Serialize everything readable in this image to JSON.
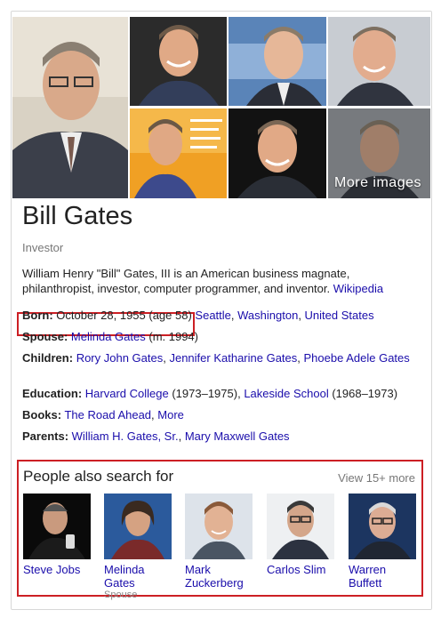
{
  "gallery": {
    "more_images_label": "More images"
  },
  "entity": {
    "name": "Bill Gates",
    "type": "Investor",
    "description": "William Henry \"Bill\" Gates, III is an American business magnate, philanthropist, investor, computer programmer, and inventor.",
    "source_link": "Wikipedia"
  },
  "facts": {
    "born": {
      "label": "Born:",
      "value": "October 28, 1955 (age 58)",
      "links": [
        "Seattle",
        "Washington",
        "United States"
      ]
    },
    "spouse": {
      "label": "Spouse:",
      "link": "Melinda Gates",
      "suffix": " (m. 1994)"
    },
    "children": {
      "label": "Children:",
      "links": [
        "Rory John Gates",
        "Jennifer Katharine Gates",
        "Phoebe Adele Gates"
      ]
    },
    "education": {
      "label": "Education:",
      "link1": "Harvard College",
      "years1": " (1973–1975), ",
      "link2": "Lakeside School",
      "years2": " (1968–1973)"
    },
    "books": {
      "label": "Books:",
      "link1": "The Road Ahead",
      "link2": "More"
    },
    "parents": {
      "label": "Parents:",
      "links": [
        "William H. Gates, Sr.",
        "Mary Maxwell Gates"
      ]
    }
  },
  "people_also_search": {
    "title": "People also search for",
    "view_more": "View 15+ more",
    "people": [
      {
        "name": "Steve Jobs",
        "relation": ""
      },
      {
        "name": "Melinda Gates",
        "relation": "Spouse"
      },
      {
        "name": "Mark Zuckerberg",
        "relation": ""
      },
      {
        "name": "Carlos Slim",
        "relation": ""
      },
      {
        "name": "Warren Buffett",
        "relation": ""
      }
    ]
  },
  "colors": {
    "link": "#1a0dab",
    "highlight_border": "#cc1f24",
    "muted": "#777777"
  }
}
